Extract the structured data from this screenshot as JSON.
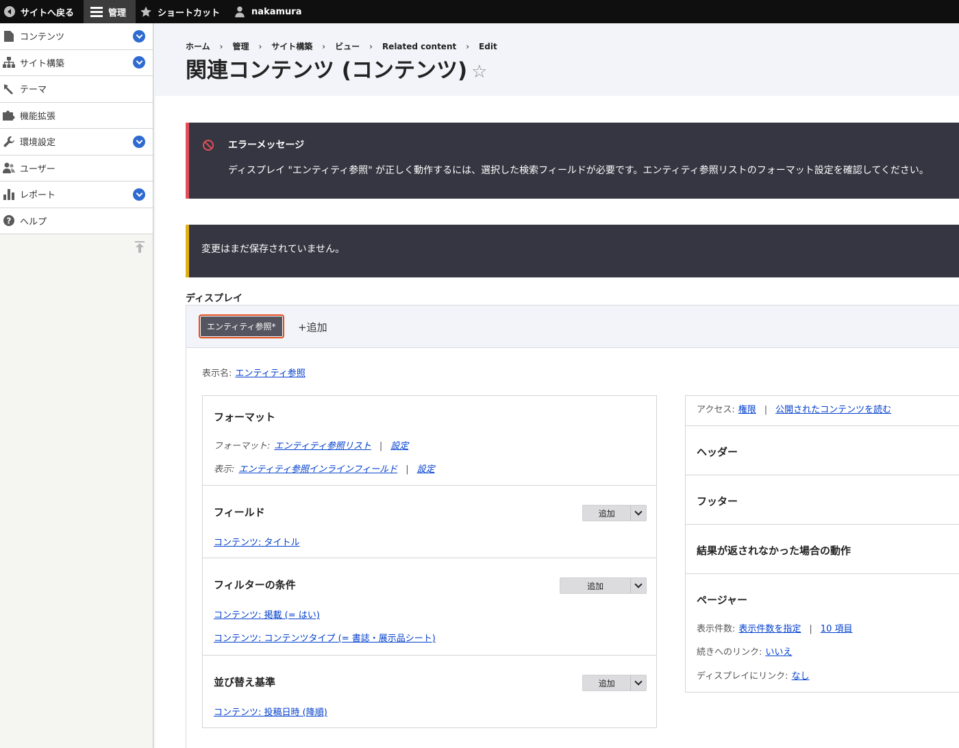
{
  "toolbar": {
    "back": "サイトへ戻る",
    "manage": "管理",
    "shortcuts": "ショートカット",
    "user": "nakamura"
  },
  "sidebar": {
    "items": [
      {
        "label": "コンテンツ",
        "icon": "file-icon",
        "expandable": true
      },
      {
        "label": "サイト構築",
        "icon": "sitemap-icon",
        "expandable": true
      },
      {
        "label": "テーマ",
        "icon": "paintbrush-icon",
        "expandable": false
      },
      {
        "label": "機能拡張",
        "icon": "puzzle-icon",
        "expandable": false
      },
      {
        "label": "環境設定",
        "icon": "wrench-icon",
        "expandable": true
      },
      {
        "label": "ユーザー",
        "icon": "people-icon",
        "expandable": false
      },
      {
        "label": "レポート",
        "icon": "bar-chart-icon",
        "expandable": true
      },
      {
        "label": "ヘルプ",
        "icon": "help-icon",
        "expandable": false
      }
    ]
  },
  "breadcrumb": [
    "ホーム",
    "管理",
    "サイト構築",
    "ビュー",
    "Related content",
    "Edit"
  ],
  "page": {
    "title": "関連コンテンツ (コンテンツ)",
    "star": "☆"
  },
  "messages": {
    "error_title": "エラーメッセージ",
    "error_body": "ディスプレイ \"エンティティ参照\" が正しく動作するには、選択した検索フィールドが必要です。エンティティ参照リストのフォーマット設定を確認してください。",
    "warning_body": "変更はまだ保存されていません。"
  },
  "displays": {
    "label": "ディスプレイ",
    "active_tab": "エンティティ参照*",
    "add": "+追加",
    "display_name_label": "表示名:",
    "display_name_value": "エンティティ参照"
  },
  "format": {
    "title": "フォーマット",
    "format_label": "フォーマット:",
    "format_value": "エンティティ参照リスト",
    "format_settings": "設定",
    "show_label": "表示:",
    "show_value": "エンティティ参照インラインフィールド",
    "show_settings": "設定"
  },
  "fields": {
    "title": "フィールド",
    "add": "追加",
    "items": [
      "コンテンツ: タイトル"
    ]
  },
  "filters": {
    "title": "フィルターの条件",
    "add": "追加",
    "items": [
      "コンテンツ: 掲載 (= はい)",
      "コンテンツ: コンテンツタイプ (= 書誌・展示品シート)"
    ]
  },
  "sorts": {
    "title": "並び替え基準",
    "add": "追加",
    "items": [
      "コンテンツ: 投稿日時 (降順)"
    ]
  },
  "right": {
    "access_label": "アクセス:",
    "access_value": "権限",
    "access_value2": "公開されたコンテンツを読む",
    "header": "ヘッダー",
    "footer": "フッター",
    "no_results": "結果が返されなかった場合の動作",
    "pager": "ページャー",
    "items_label": "表示件数:",
    "items_value": "表示件数を指定",
    "items_count": "10 項目",
    "more_label": "続きへのリンク:",
    "more_value": "いいえ",
    "link_label": "ディスプレイにリンク:",
    "link_value": "なし"
  }
}
